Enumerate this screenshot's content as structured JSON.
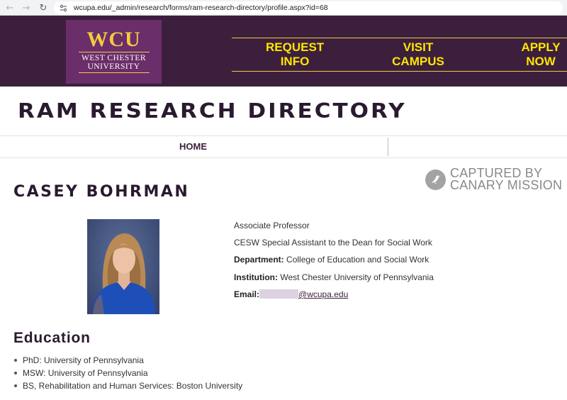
{
  "browser": {
    "back_icon": "←",
    "forward_icon": "→",
    "reload_icon": "↻",
    "url": "wcupa.edu/_admin/research/forms/ram-research-directory/profile.aspx?id=68"
  },
  "header": {
    "logo": {
      "mark": "WCU",
      "line1": "WEST CHESTER",
      "line2": "UNIVERSITY"
    },
    "ctas": [
      {
        "line1": "REQUEST",
        "line2": "INFO"
      },
      {
        "line1": "VISIT",
        "line2": "CAMPUS"
      },
      {
        "line1": "APPLY",
        "line2": "NOW"
      }
    ],
    "colors": {
      "band": "#3c1f3d",
      "logo_bg": "#6a2e6a",
      "gold": "#f7c940",
      "cta": "#ffe600"
    }
  },
  "directory_title": "RAM RESEARCH DIRECTORY",
  "nav": {
    "home": "HOME"
  },
  "watermark": {
    "line1": "CAPTURED BY",
    "line2": "CANARY MISSION"
  },
  "profile": {
    "name": "CASEY BOHRMAN",
    "title": "Associate Professor",
    "role": "CESW Special Assistant to the Dean for Social Work",
    "department_label": "Department:",
    "department": "College of Education and Social Work",
    "institution_label": "Institution:",
    "institution": "West Chester University of Pennsylvania",
    "email_label": "Email:",
    "email_domain": "@wcupa.edu"
  },
  "education": {
    "heading": "Education",
    "items": [
      "PhD: University of Pennsylvania",
      "MSW: University of Pennsylvania",
      "BS, Rehabilitation and Human Services: Boston University"
    ]
  }
}
